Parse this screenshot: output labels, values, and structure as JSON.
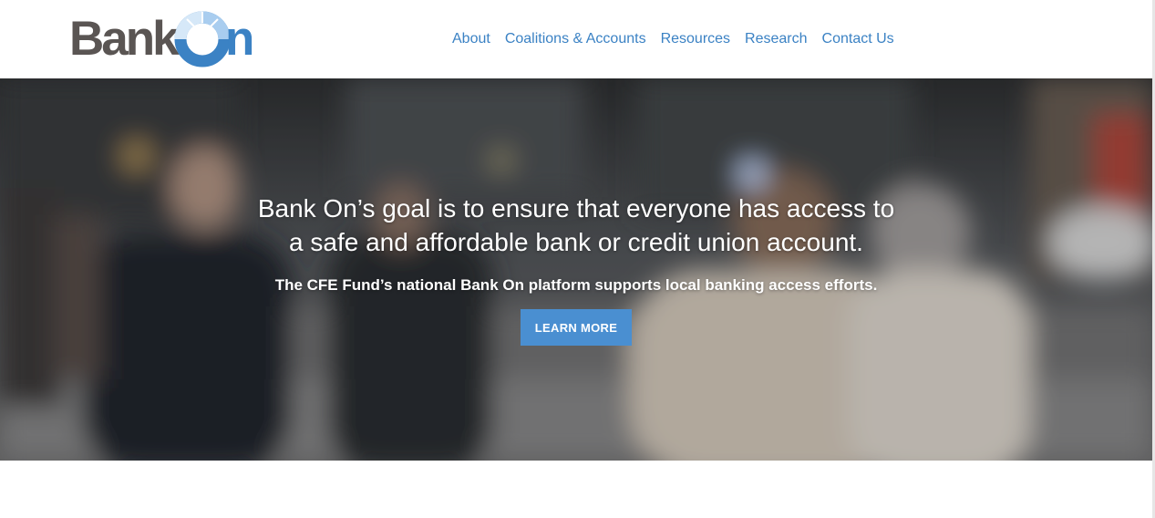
{
  "brand": {
    "name_part1": "Bank",
    "name_part2": "n",
    "colors": {
      "text_gray": "#5a5553",
      "blue": "#3b82c4",
      "light_blue": "#a9cdef"
    }
  },
  "nav": {
    "items": [
      {
        "label": "About"
      },
      {
        "label": "Coalitions & Accounts"
      },
      {
        "label": "Resources"
      },
      {
        "label": "Research"
      },
      {
        "label": "Contact Us"
      }
    ]
  },
  "hero": {
    "headline_line1": "Bank On’s goal is to ensure that everyone has access to",
    "headline_line2": "a safe and affordable bank or credit union account.",
    "subheadline": "The CFE Fund’s national Bank On platform supports local banking access efforts.",
    "cta_label": "LEARN MORE",
    "background_image": "blurred-city-street-pedestrians"
  },
  "colors": {
    "nav_link": "#3b82c4",
    "cta_bg": "#4a8fd1",
    "hero_text": "#ffffff"
  }
}
